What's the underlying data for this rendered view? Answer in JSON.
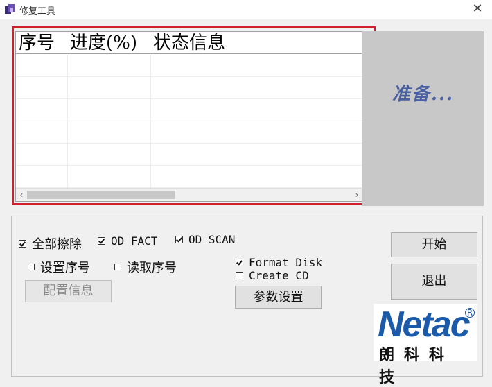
{
  "window": {
    "title": "修复工具",
    "close_glyph": "✕"
  },
  "table": {
    "columns": [
      "序号",
      "进度(%)",
      "状态信息"
    ],
    "rows": [],
    "scroll_left": "‹",
    "scroll_right": "›"
  },
  "status": {
    "text": "准备..."
  },
  "options": {
    "erase_all": {
      "label": "全部擦除",
      "checked": true
    },
    "od_fact": {
      "label": "OD FACT",
      "checked": true
    },
    "od_scan": {
      "label": "OD SCAN",
      "checked": true
    },
    "set_serial": {
      "label": "设置序号",
      "checked": false
    },
    "read_serial": {
      "label": "读取序号",
      "checked": false
    },
    "format_disk": {
      "label": "Format Disk",
      "checked": true
    },
    "create_cd": {
      "label": "Create CD",
      "checked": false
    }
  },
  "buttons": {
    "config": "配置信息",
    "params": "参数设置",
    "start": "开始",
    "exit": "退出"
  },
  "logo": {
    "brand": "Netac",
    "brand_cn": "朗科科技",
    "registered": "R"
  }
}
